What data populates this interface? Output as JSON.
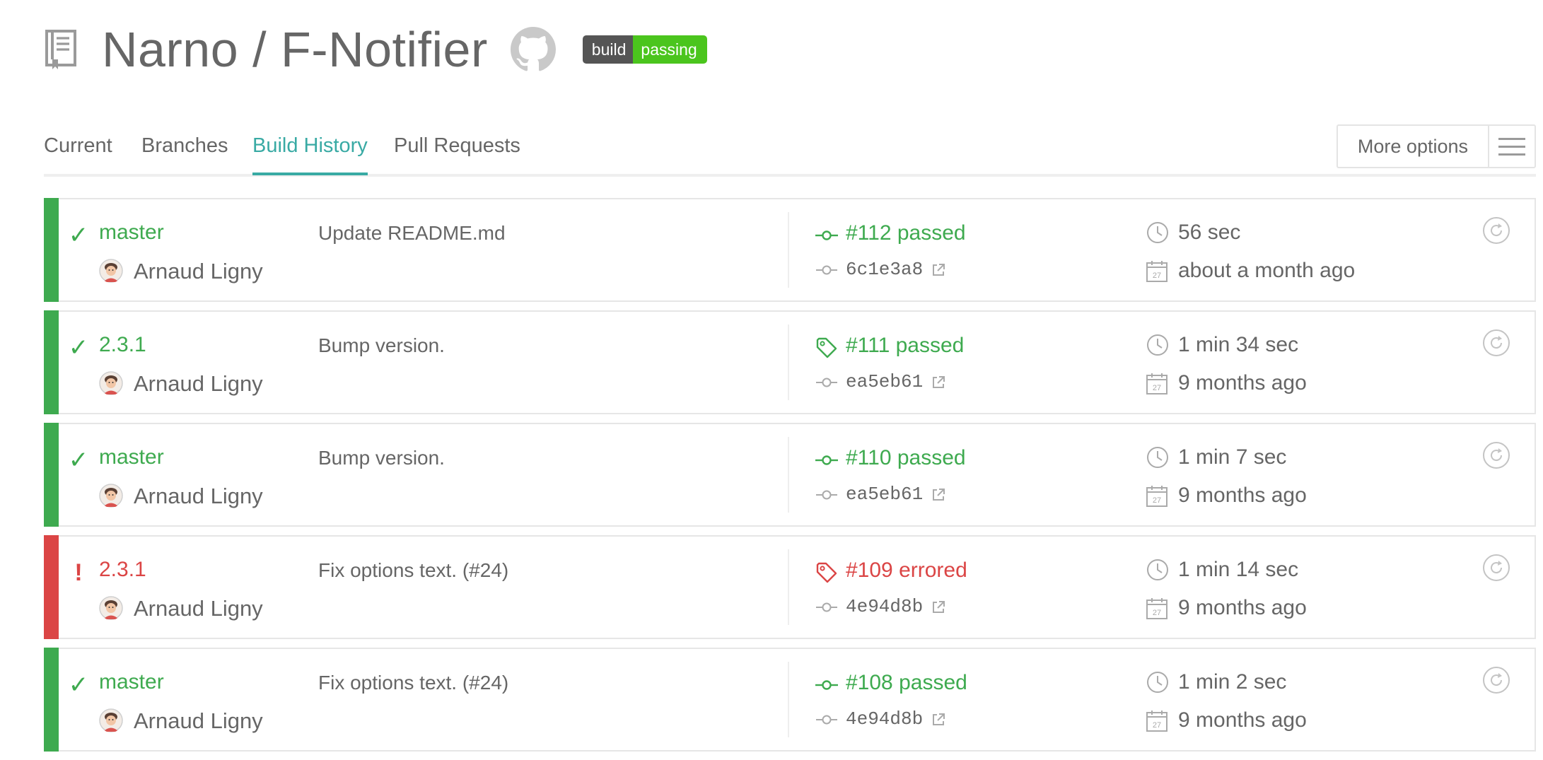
{
  "repo": {
    "title": "Narno / F-Notifier",
    "badge_left": "build",
    "badge_right": "passing",
    "repo_icon": "repo-book-icon",
    "github_icon": "github-icon"
  },
  "tabs": [
    {
      "label": "Current",
      "active": false
    },
    {
      "label": "Branches",
      "active": false
    },
    {
      "label": "Build History",
      "active": true
    },
    {
      "label": "Pull Requests",
      "active": false
    }
  ],
  "more_options": {
    "label": "More options",
    "icon": "hamburger-menu-icon"
  },
  "colors": {
    "passed": "#3eaa4f",
    "errored": "#db4545",
    "accent": "#39aaa4",
    "badge_passing": "#4bc51d"
  },
  "builds": [
    {
      "status": "passed",
      "branch": "master",
      "author": "Arnaud Ligny",
      "message": "Update README.md",
      "build_type": "push",
      "build_number": "#112 passed",
      "commit": "6c1e3a8",
      "duration": "56 sec",
      "finished": "about a month ago"
    },
    {
      "status": "passed",
      "branch": "2.3.1",
      "author": "Arnaud Ligny",
      "message": "Bump version.",
      "build_type": "tag",
      "build_number": "#111 passed",
      "commit": "ea5eb61",
      "duration": "1 min 34 sec",
      "finished": "9 months ago"
    },
    {
      "status": "passed",
      "branch": "master",
      "author": "Arnaud Ligny",
      "message": "Bump version.",
      "build_type": "push",
      "build_number": "#110 passed",
      "commit": "ea5eb61",
      "duration": "1 min 7 sec",
      "finished": "9 months ago"
    },
    {
      "status": "errored",
      "branch": "2.3.1",
      "author": "Arnaud Ligny",
      "message": "Fix options text. (#24)",
      "build_type": "tag",
      "build_number": "#109 errored",
      "commit": "4e94d8b",
      "duration": "1 min 14 sec",
      "finished": "9 months ago"
    },
    {
      "status": "passed",
      "branch": "master",
      "author": "Arnaud Ligny",
      "message": "Fix options text. (#24)",
      "build_type": "push",
      "build_number": "#108 passed",
      "commit": "4e94d8b",
      "duration": "1 min 2 sec",
      "finished": "9 months ago"
    }
  ],
  "calendar_icon_day": "27"
}
